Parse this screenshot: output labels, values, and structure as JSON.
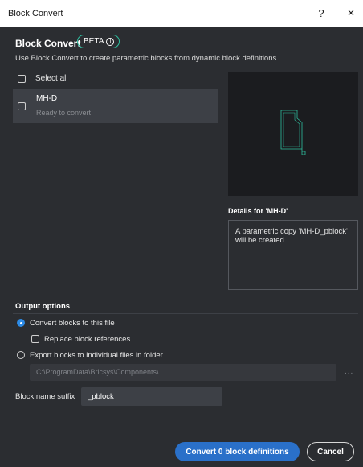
{
  "window": {
    "title": "Block Convert",
    "help_label": "?",
    "close_label": "×"
  },
  "header": {
    "heading": "Block Convert",
    "badge": "BETA",
    "badge_info_icon": "i",
    "description": "Use Block Convert to create parametric blocks from dynamic block definitions."
  },
  "list": {
    "select_all_label": "Select all",
    "items": [
      {
        "name": "MH-D",
        "status": "Ready to convert"
      }
    ]
  },
  "details": {
    "title": "Details for 'MH-D'",
    "text": "A parametric copy 'MH-D_pblock' will be created."
  },
  "output": {
    "title": "Output options",
    "option_convert": "Convert blocks to this file",
    "option_replace": "Replace block references",
    "option_export": "Export blocks to individual files in folder",
    "folder_path": "C:\\ProgramData\\Bricsys\\Components\\",
    "browse_label": "...",
    "suffix_label": "Block name suffix",
    "suffix_value": "_pblock"
  },
  "buttons": {
    "convert": "Convert 0 block definitions",
    "cancel": "Cancel"
  },
  "colors": {
    "accent": "#2a70c9",
    "badge_border": "#2fbf9f",
    "preview_stroke": "#2fbf9f"
  }
}
